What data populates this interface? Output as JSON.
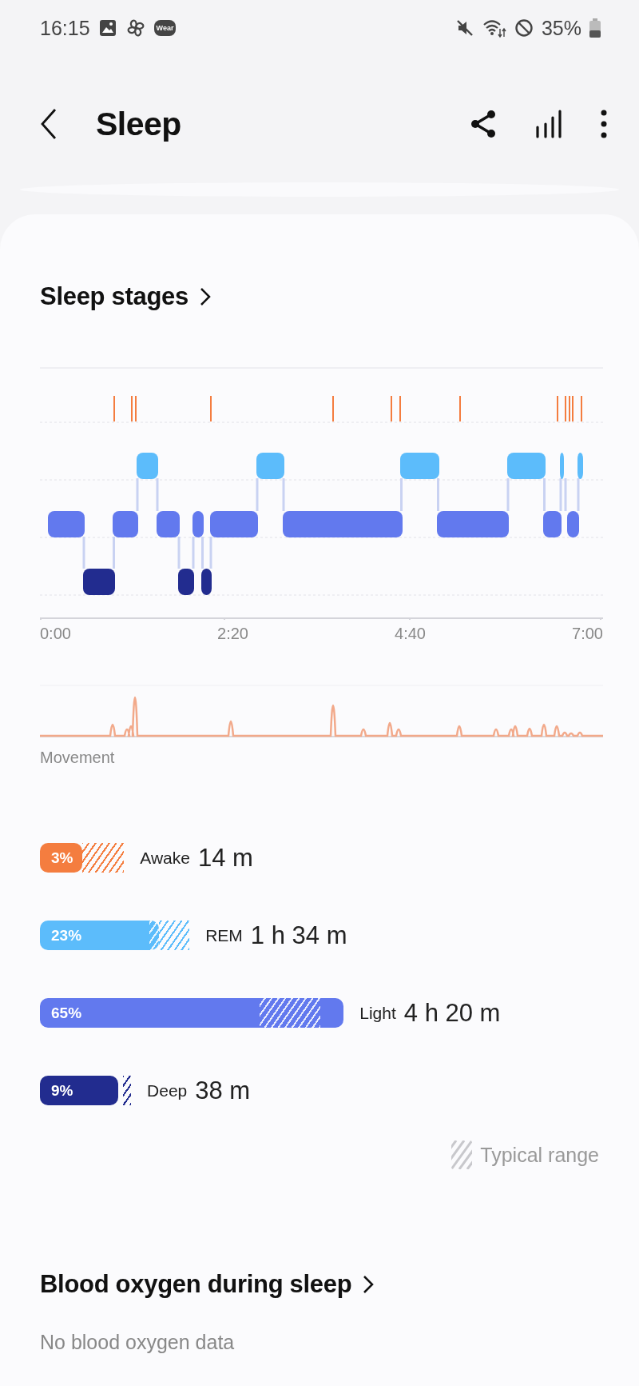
{
  "status_bar": {
    "time": "16:15",
    "badge": "Wear",
    "battery": "35%"
  },
  "header": {
    "title": "Sleep"
  },
  "stages_section": {
    "title": "Sleep stages",
    "time_labels": [
      "0:00",
      "2:20",
      "4:40",
      "7:00"
    ],
    "movement_label": "Movement",
    "stages": [
      {
        "kind": "awake",
        "percent": "3%",
        "label": "Awake",
        "duration": "14 m",
        "color": "#f47d3f"
      },
      {
        "kind": "rem",
        "percent": "23%",
        "label": "REM",
        "duration": "1 h 34 m",
        "color": "#5cbcfb"
      },
      {
        "kind": "light",
        "percent": "65%",
        "label": "Light",
        "duration": "4 h 20 m",
        "color": "#6279ee"
      },
      {
        "kind": "deep",
        "percent": "9%",
        "label": "Deep",
        "duration": "38 m",
        "color": "#222c8f"
      }
    ],
    "legend": "Typical range"
  },
  "blood_oxygen": {
    "title": "Blood oxygen during sleep",
    "message": "No blood oxygen data"
  }
}
